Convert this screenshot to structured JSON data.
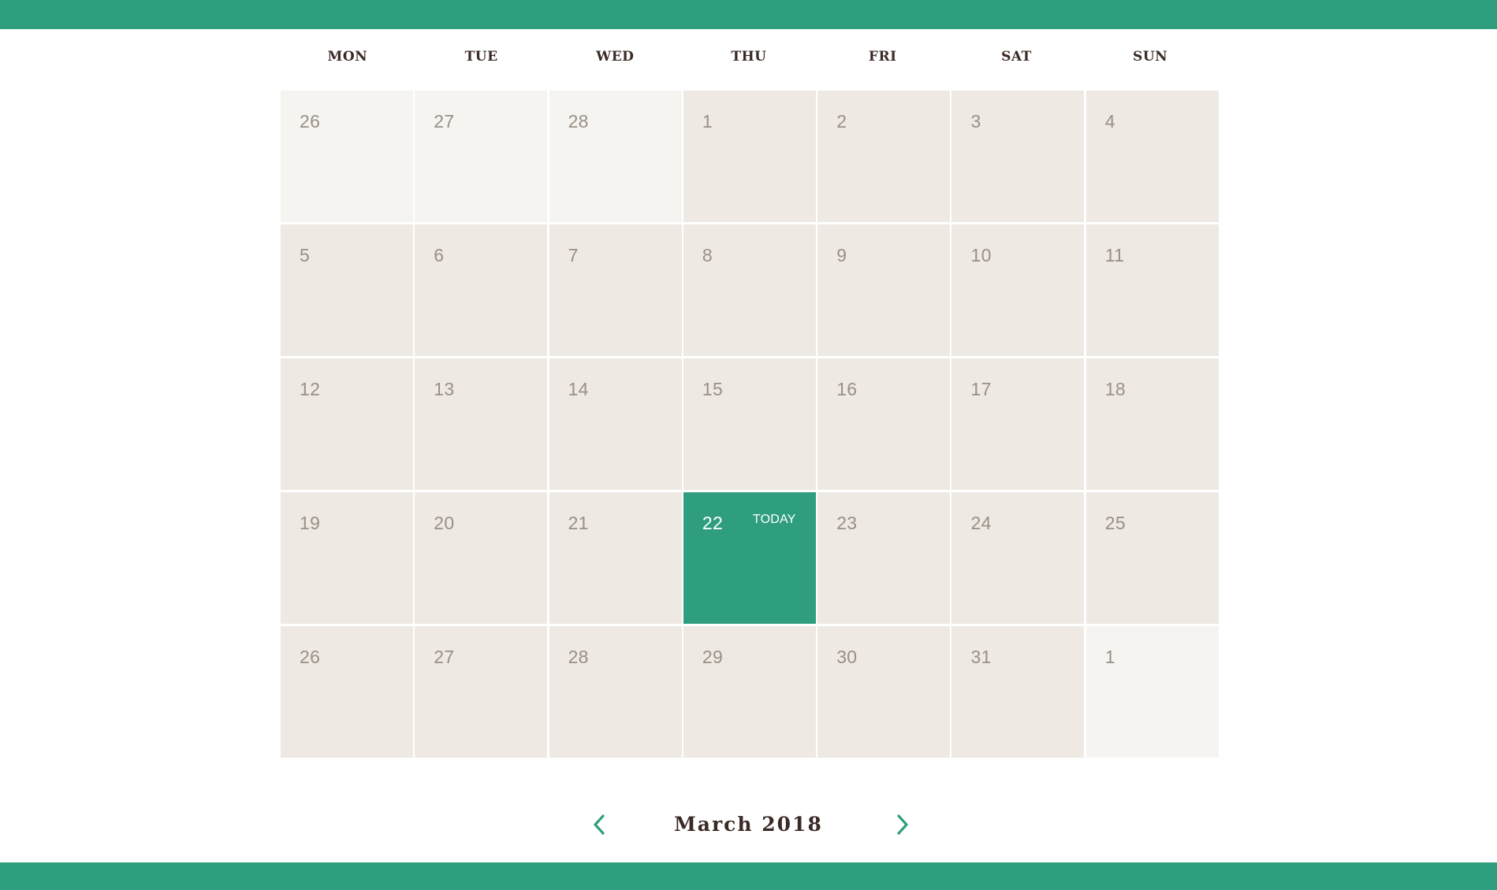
{
  "colors": {
    "accent": "#2f9e7e",
    "cell_bg": "#eee9e3",
    "cell_muted_bg": "#f5f4f1",
    "day_number": "#9a8f85",
    "heading_text": "#3a2a25"
  },
  "weekdays": [
    "MON",
    "TUE",
    "WED",
    "THU",
    "FRI",
    "SAT",
    "SUN"
  ],
  "weeks": [
    [
      {
        "day": "26",
        "muted": true
      },
      {
        "day": "27",
        "muted": true
      },
      {
        "day": "28",
        "muted": true
      },
      {
        "day": "1"
      },
      {
        "day": "2"
      },
      {
        "day": "3"
      },
      {
        "day": "4"
      }
    ],
    [
      {
        "day": "5"
      },
      {
        "day": "6"
      },
      {
        "day": "7"
      },
      {
        "day": "8"
      },
      {
        "day": "9"
      },
      {
        "day": "10"
      },
      {
        "day": "11"
      }
    ],
    [
      {
        "day": "12"
      },
      {
        "day": "13"
      },
      {
        "day": "14"
      },
      {
        "day": "15"
      },
      {
        "day": "16"
      },
      {
        "day": "17"
      },
      {
        "day": "18"
      }
    ],
    [
      {
        "day": "19"
      },
      {
        "day": "20"
      },
      {
        "day": "21"
      },
      {
        "day": "22",
        "today": true,
        "badge": "TODAY"
      },
      {
        "day": "23"
      },
      {
        "day": "24"
      },
      {
        "day": "25"
      }
    ],
    [
      {
        "day": "26"
      },
      {
        "day": "27"
      },
      {
        "day": "28"
      },
      {
        "day": "29"
      },
      {
        "day": "30"
      },
      {
        "day": "31"
      },
      {
        "day": "1",
        "muted": true
      }
    ]
  ],
  "navigation": {
    "month_label": "March 2018",
    "prev_icon": "chevron-left-icon",
    "next_icon": "chevron-right-icon"
  }
}
